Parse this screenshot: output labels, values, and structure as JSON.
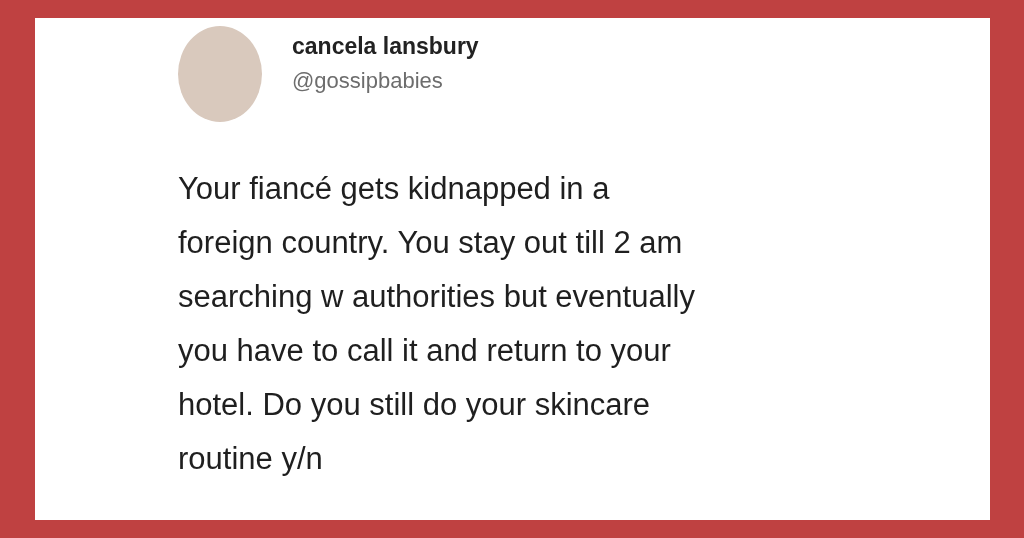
{
  "tweet": {
    "author_name": "cancela lansbury",
    "handle": "@gossipbabies",
    "body_lines": [
      "Your fiancé gets kidnapped in a",
      "foreign country. You stay out till 2 am",
      "searching w authorities but eventually",
      "you have to call it and return to your",
      "hotel. Do you still do your skincare",
      "routine y/n"
    ]
  }
}
